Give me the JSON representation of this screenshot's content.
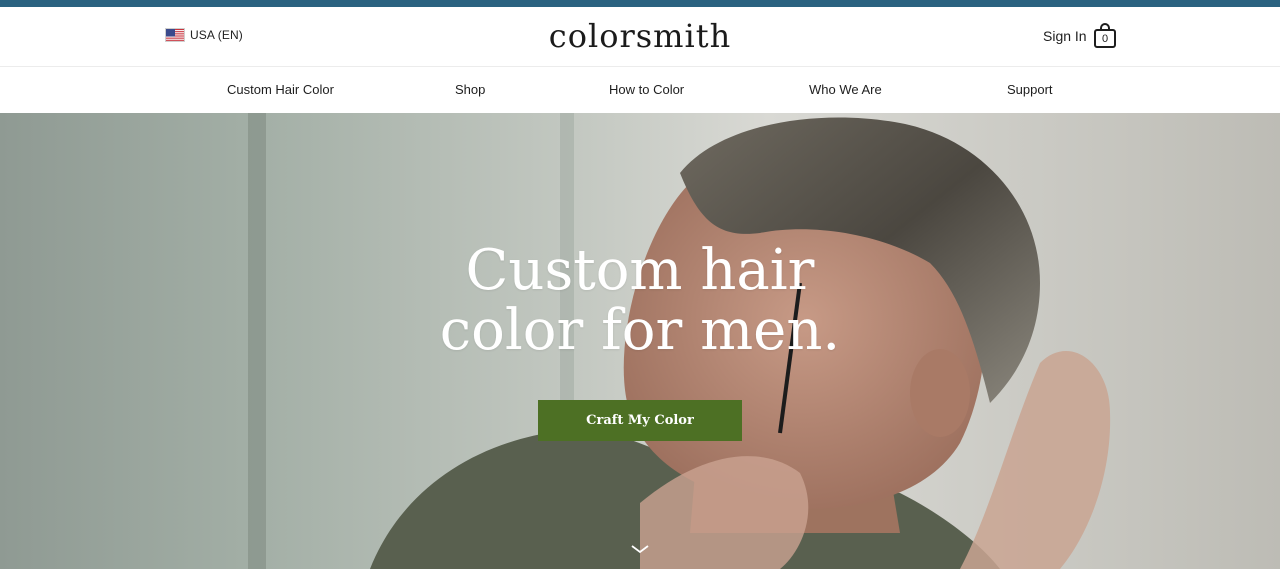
{
  "header": {
    "locale_label": "USA (EN)",
    "logo_text": "colorsmith",
    "signin_label": "Sign In",
    "cart_count": "0"
  },
  "nav": {
    "items": [
      {
        "label": "Custom Hair Color"
      },
      {
        "label": "Shop"
      },
      {
        "label": "How to Color"
      },
      {
        "label": "Who We Are"
      },
      {
        "label": "Support"
      }
    ]
  },
  "hero": {
    "title_line1": "Custom hair",
    "title_line2": "color for men.",
    "cta_label": "Craft My Color"
  },
  "colors": {
    "top_strip": "#2a6280",
    "cta_background": "#4d7024",
    "cta_text": "#ffffff",
    "hero_text": "#ffffff"
  },
  "icons": {
    "locale": "us-flag-icon",
    "cart": "shopping-bag-icon",
    "scroll": "chevron-down-icon"
  }
}
